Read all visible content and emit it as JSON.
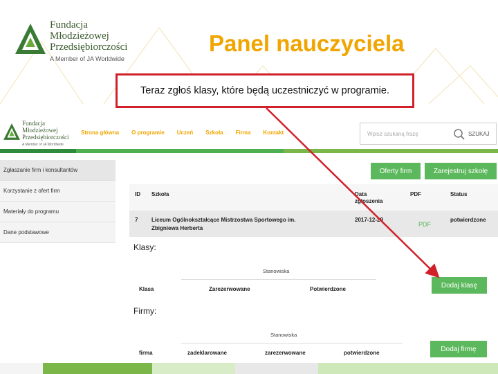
{
  "slide": {
    "org_line1": "Fundacja",
    "org_line2": "Młodzieżowej",
    "org_line3": "Przedsiębiorczości",
    "member": "A Member of JA Worldwide",
    "title": "Panel nauczyciela",
    "callout": "Teraz zgłoś klasy, które będą uczestniczyć w programie."
  },
  "app": {
    "logo": {
      "line1": "Fundacja",
      "line2": "Młodzieżowej",
      "line3": "Przedsiębiorczości",
      "member": "A Member of JA Worldwide"
    },
    "nav": [
      "Strona główna",
      "O programie",
      "Uczeń",
      "Szkoła",
      "Firma",
      "Kontakt"
    ],
    "search": {
      "placeholder": "Wpisz szukaną frazę",
      "button": "SZUKAJ"
    },
    "sidebar": [
      "Zgłaszanie firm i konsultantów",
      "Korzystanie z ofert firm",
      "Materiały do programu",
      "Dane podstawowe"
    ],
    "buttons": {
      "oferty": "Oferty firm",
      "zarejestruj": "Zarejestruj szkołę",
      "dodaj_klase": "Dodaj klasę",
      "dodaj_firme": "Dodaj firmę"
    },
    "school_table": {
      "headers": {
        "id": "ID",
        "szkola": "Szkoła",
        "data_1": "Data",
        "data_2": "zgłoszenia",
        "pdf": "PDF",
        "status": "Status"
      },
      "row": {
        "id": "7",
        "szkola_1": "Liceum Ogólnokształcące Mistrzostwa Sportowego im.",
        "szkola_2": "Zbigniewa Herberta",
        "data": "2017-12-29",
        "pdf": "PDF",
        "status": "potwierdzone"
      }
    },
    "klasy": {
      "label": "Klasy:",
      "group": "Stanowiska",
      "columns": [
        "Klasa",
        "Zarezerwowane",
        "Potwierdzone"
      ]
    },
    "firmy": {
      "label": "Firmy:",
      "group": "Stanowiska",
      "columns": [
        "firma",
        "zadeklarowane",
        "zarezerwowane",
        "potwierdzone"
      ]
    }
  },
  "colors": {
    "accent": "#f0a500",
    "green": "#5cb85c",
    "callout_border": "#d0202a",
    "arrow": "#d0202a"
  }
}
